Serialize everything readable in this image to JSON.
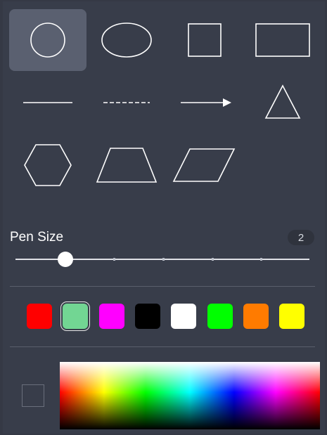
{
  "shapes": [
    {
      "name": "circle-icon",
      "selected": true
    },
    {
      "name": "ellipse-icon",
      "selected": false
    },
    {
      "name": "square-icon",
      "selected": false
    },
    {
      "name": "rectangle-icon",
      "selected": false
    },
    {
      "name": "line-icon",
      "selected": false
    },
    {
      "name": "dashed-line-icon",
      "selected": false
    },
    {
      "name": "arrow-icon",
      "selected": false
    },
    {
      "name": "triangle-icon",
      "selected": false
    },
    {
      "name": "hexagon-icon",
      "selected": false
    },
    {
      "name": "trapezoid-icon",
      "selected": false
    },
    {
      "name": "parallelogram-icon",
      "selected": false
    }
  ],
  "pen_size": {
    "label": "Pen Size",
    "value": "2",
    "slider_fraction": 0.17,
    "ticks": 6
  },
  "colors": {
    "swatches": [
      "#ff0000",
      "#72d693",
      "#ff00ff",
      "#000000",
      "#ffffff",
      "#00ff00",
      "#ff7b00",
      "#ffff00"
    ],
    "selected_index": 1
  }
}
